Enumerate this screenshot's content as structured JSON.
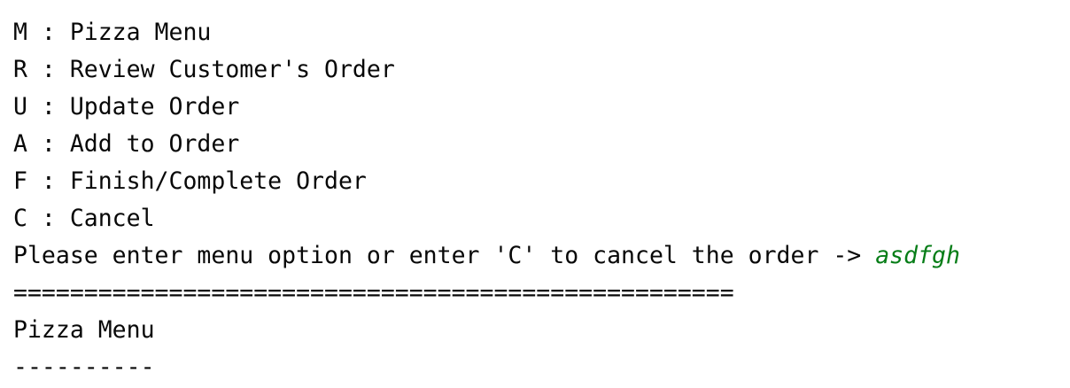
{
  "console": {
    "menu_lines": [
      "M : Pizza Menu",
      "R : Review Customer's Order",
      "U : Update Order",
      "A : Add to Order",
      "F : Finish/Complete Order",
      "C : Cancel"
    ],
    "prompt": "Please enter menu option or enter 'C' to cancel the order -> ",
    "user_input": "asdfgh",
    "separator_double": "===================================================",
    "section_title": "Pizza Menu",
    "separator_single": "----------"
  },
  "colors": {
    "text": "#080808",
    "user_input": "#067d17",
    "background": "#ffffff"
  }
}
